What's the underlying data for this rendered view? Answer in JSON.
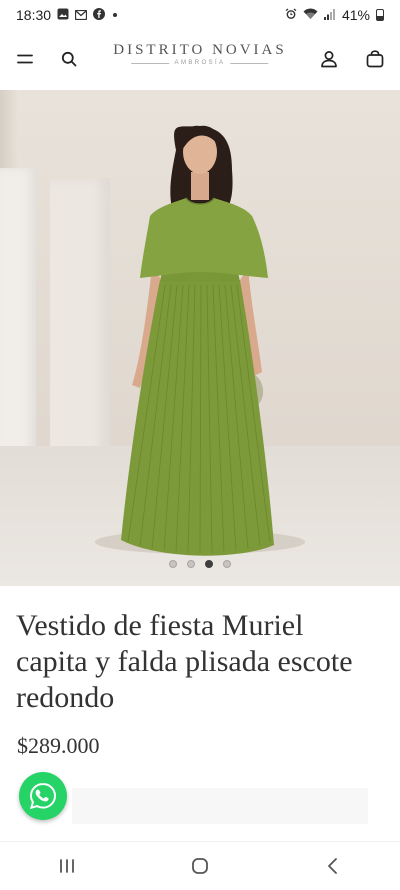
{
  "status_bar": {
    "time": "18:30",
    "battery": "41%",
    "left_icons": [
      "gallery-icon",
      "gmail-icon",
      "facebook-icon",
      "notification-dot"
    ],
    "right_icons": [
      "alarm-icon",
      "wifi-icon",
      "signal-icon",
      "battery-icon"
    ]
  },
  "header": {
    "brand_name": "DISTRITO NOVIAS",
    "brand_sub": "AMBROSÍA",
    "icons": [
      "menu-icon",
      "search-icon",
      "account-icon",
      "bag-icon"
    ]
  },
  "product": {
    "title": "Vestido de fiesta Muriel capita y falda plisada escote redondo",
    "currency": "$",
    "price": "289.000",
    "dress_color": "#7d9a3a",
    "image_count": 4,
    "active_image": 3
  },
  "whatsapp": {
    "icon": "whatsapp-icon",
    "color": "#25d366"
  },
  "nav": {
    "icons": [
      "recent-apps-icon",
      "home-icon",
      "back-icon"
    ]
  }
}
